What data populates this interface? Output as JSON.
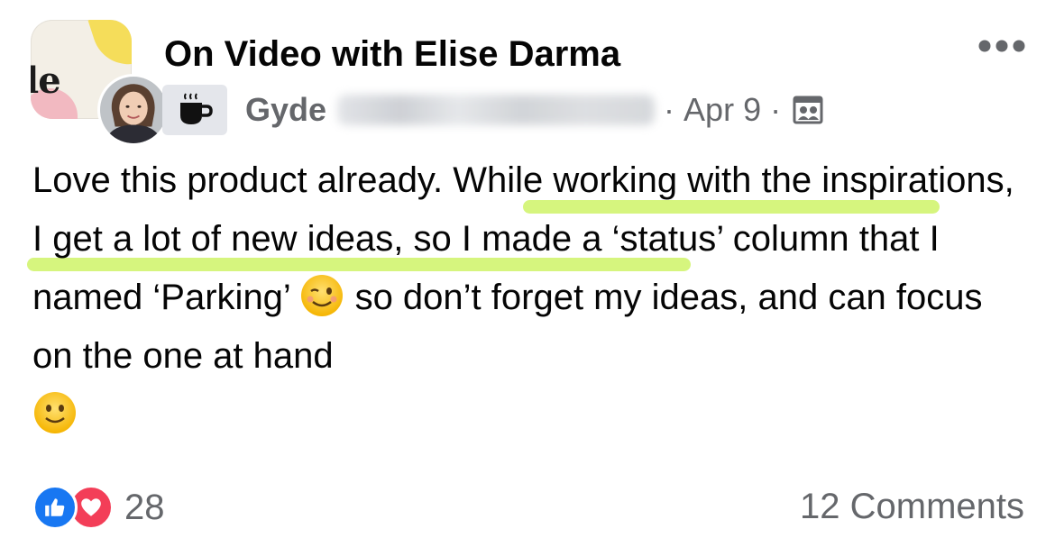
{
  "post": {
    "group_name": "On Video with Elise Darma",
    "group_avatar_text": "le",
    "author": "Gyde",
    "meta_separator": "·",
    "date": "Apr 9",
    "body": {
      "part1": "Love this product already. ",
      "highlight1": "While working with the",
      "part2": " ",
      "highlight2": "inspirations, I get a lot of new ideas",
      "part3": ", so I made a ‘status’ column that I named ‘Parking’ ",
      "part4": " so don’t forget my ideas, and can focus on the one at hand"
    },
    "highlight_color": "#d6f57e"
  },
  "footer": {
    "reaction_count": "28",
    "comments_label": "12 Comments"
  },
  "icons": {
    "more": "more-options-icon",
    "badge": "coffee-cup-icon",
    "audience": "group-audience-icon",
    "like": "like-icon",
    "love": "love-icon",
    "wink": "winking-face-emoji",
    "smile": "smiling-face-emoji"
  },
  "colors": {
    "text_primary": "#050505",
    "text_secondary": "#65676b",
    "like_blue": "#1877f2",
    "love_red": "#f33e58"
  }
}
